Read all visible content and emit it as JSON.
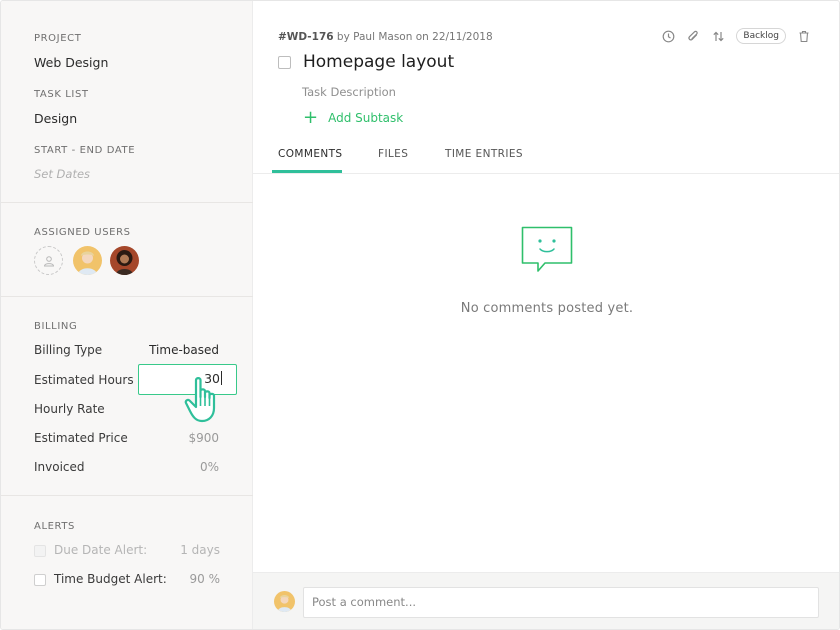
{
  "sidebar": {
    "project_label": "PROJECT",
    "project_value": "Web Design",
    "tasklist_label": "TASK LIST",
    "tasklist_value": "Design",
    "dates_label": "START - END DATE",
    "dates_placeholder": "Set Dates",
    "assigned_label": "ASSIGNED USERS",
    "billing": {
      "label": "BILLING",
      "rows": [
        {
          "label": "Billing Type",
          "value": "Time-based"
        },
        {
          "label": "Estimated Hours",
          "value": "30"
        },
        {
          "label": "Hourly Rate",
          "value": ""
        },
        {
          "label": "Estimated Price",
          "value": "$900"
        },
        {
          "label": "Invoiced",
          "value": "0%"
        }
      ]
    },
    "alerts": {
      "label": "ALERTS",
      "items": [
        {
          "label": "Due Date Alert:",
          "value": "1 days",
          "disabled": true
        },
        {
          "label": "Time Budget Alert:",
          "value": "90 %",
          "disabled": false
        }
      ]
    }
  },
  "task": {
    "id": "#WD-176",
    "meta_rest": " by Paul Mason on 22/11/2018",
    "status_badge": "Backlog",
    "title": "Homepage layout",
    "description_placeholder": "Task Description",
    "add_subtask": "Add Subtask"
  },
  "tabs": [
    {
      "label": "COMMENTS",
      "active": true
    },
    {
      "label": "FILES",
      "active": false
    },
    {
      "label": "TIME ENTRIES",
      "active": false
    }
  ],
  "comments": {
    "empty_text": "No comments posted yet.",
    "input_placeholder": "Post a comment..."
  },
  "colors": {
    "accent_green": "#2fbf6b",
    "tab_underline": "#2fbf9a",
    "input_focus": "#38c98a"
  }
}
